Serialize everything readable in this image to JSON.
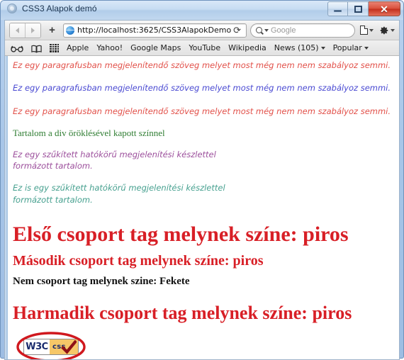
{
  "window": {
    "title": "CSS3 Alapok demó",
    "app_icon": "safari-compass-icon",
    "buttons": {
      "minimize": "—",
      "maximize": "▢",
      "close": "✕"
    }
  },
  "toolbar": {
    "back_icon": "back-arrow-icon",
    "forward_icon": "forward-arrow-icon",
    "new_tab_label": "+",
    "url": "http://localhost:3625/CSS3AlapokDemo.htm",
    "reload_icon": "reload-icon",
    "search_placeholder": "Google",
    "search_icon": "magnifier-icon",
    "page_actions_icon": "page-icon",
    "settings_icon": "gear-icon"
  },
  "bookmarks": {
    "icons": [
      "reader-glasses-icon",
      "bookmarks-book-icon",
      "top-sites-grid-icon"
    ],
    "items": [
      {
        "label": "Apple",
        "has_menu": false
      },
      {
        "label": "Yahoo!",
        "has_menu": false
      },
      {
        "label": "Google Maps",
        "has_menu": false
      },
      {
        "label": "YouTube",
        "has_menu": false
      },
      {
        "label": "Wikipedia",
        "has_menu": false
      },
      {
        "label": "News (105)",
        "has_menu": true
      },
      {
        "label": "Popular",
        "has_menu": true
      }
    ]
  },
  "page": {
    "paragraphs": [
      {
        "text": "Ez egy paragrafusban megjelenítendő szöveg melyet most még nem nem szabályoz semmi.",
        "color": "#e2514a"
      },
      {
        "text": "Ez egy paragrafusban megjelenítendő szöveg melyet most még nem nem szabályoz semmi.",
        "color": "#4a4ad2"
      },
      {
        "text": "Ez egy paragrafusban megjelenítendő szöveg melyet most még nem nem szabályoz semmi.",
        "color": "#e2514a"
      }
    ],
    "div_inherited": {
      "text": "Tartalom a div öröklésével kapott színnel",
      "color": "#2f7d32"
    },
    "scoped_blocks": [
      {
        "text": "Ez egy szűkített hatókörű megjelenítési készlettel formázott tartalom.",
        "color": "#9c4f9c"
      },
      {
        "text": "Ez is egy szűkített hatókörű megjelenítési készlettel formázott tartalom.",
        "color": "#46a08f"
      }
    ],
    "headings": [
      {
        "level": "h1",
        "text": "Első csoport tag melynek színe: piros",
        "color": "#d81f26"
      },
      {
        "level": "h2",
        "text": "Második csoport tag melynek színe: piros",
        "color": "#d81f26"
      },
      {
        "level": "h3",
        "text": "Nem csoport tag melynek szine: Fekete",
        "color": "#111111"
      },
      {
        "level": "h1",
        "text": "Harmadik csoport tag melynek színe: piros",
        "color": "#d81f26"
      }
    ],
    "badge": {
      "left_text": "W3C",
      "right_text": "css",
      "check_icon": "checkmark-icon",
      "annotation": "red-ellipse-highlight",
      "annotation_color": "#d0181e",
      "left_bg": "#ffffff",
      "right_bg": "#f6c768",
      "text_color": "#1a2b6d"
    }
  }
}
